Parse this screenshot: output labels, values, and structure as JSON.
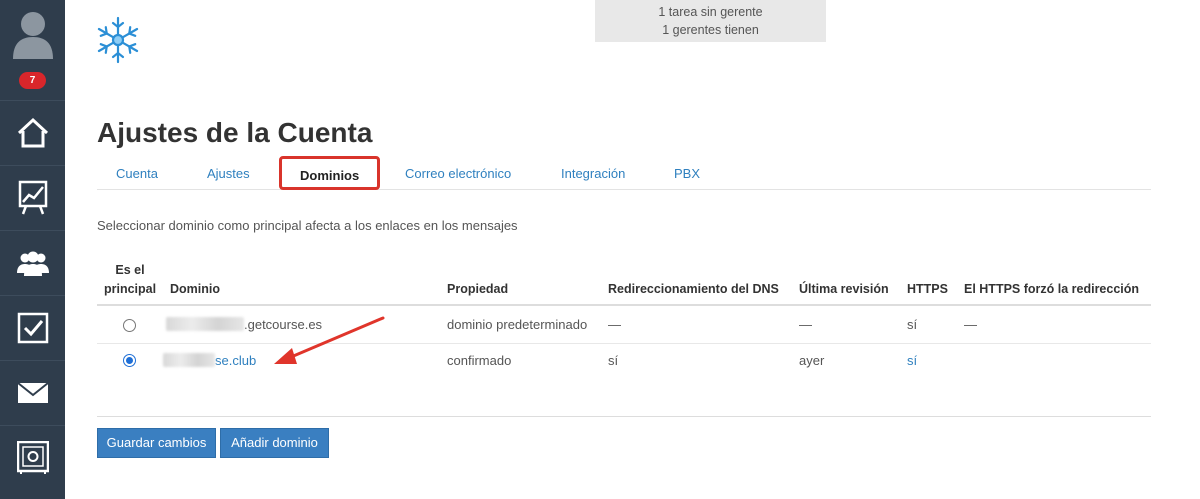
{
  "sidebar": {
    "badge_count": "7",
    "items": [
      {
        "icon": "home-icon"
      },
      {
        "icon": "chart-icon"
      },
      {
        "icon": "users-icon"
      },
      {
        "icon": "checkbox-icon"
      },
      {
        "icon": "mail-icon"
      },
      {
        "icon": "safe-icon"
      }
    ]
  },
  "notice": {
    "line1": "1 tarea sin gerente",
    "line2": "1 gerentes tienen"
  },
  "page": {
    "title": "Ajustes de la Cuenta",
    "description": "Seleccionar dominio como principal afecta a los enlaces en los mensajes"
  },
  "tabs": [
    {
      "label": "Cuenta",
      "active": false
    },
    {
      "label": "Ajustes",
      "active": false
    },
    {
      "label": "Dominios",
      "active": true
    },
    {
      "label": "Correo electrónico",
      "active": false
    },
    {
      "label": "Integración",
      "active": false
    },
    {
      "label": "PBX",
      "active": false
    }
  ],
  "table": {
    "headers": {
      "principal_line1": "Es el",
      "principal_line2": "principal",
      "domain": "Dominio",
      "property": "Propiedad",
      "dns": "Redireccionamiento del DNS",
      "last_check": "Última revisión",
      "https": "HTTPS",
      "https_forced": "El HTTPS forzó la redirección"
    },
    "rows": [
      {
        "selected": false,
        "domain": ".getcourse.es",
        "property": "dominio predeterminado",
        "dns": "—",
        "last_check": "—",
        "https": "sí",
        "https_forced": "—"
      },
      {
        "selected": true,
        "domain": "se.club",
        "property": "confirmado",
        "dns": "sí",
        "last_check": "ayer",
        "https": "sí",
        "https_forced": ""
      }
    ]
  },
  "buttons": {
    "save": "Guardar cambios",
    "add_domain": "Añadir dominio"
  },
  "colors": {
    "sidebar": "#2f3d4c",
    "link": "#2f80bf",
    "button": "#3a7fc1",
    "highlight": "#d9342b",
    "badge": "#d9262b"
  }
}
